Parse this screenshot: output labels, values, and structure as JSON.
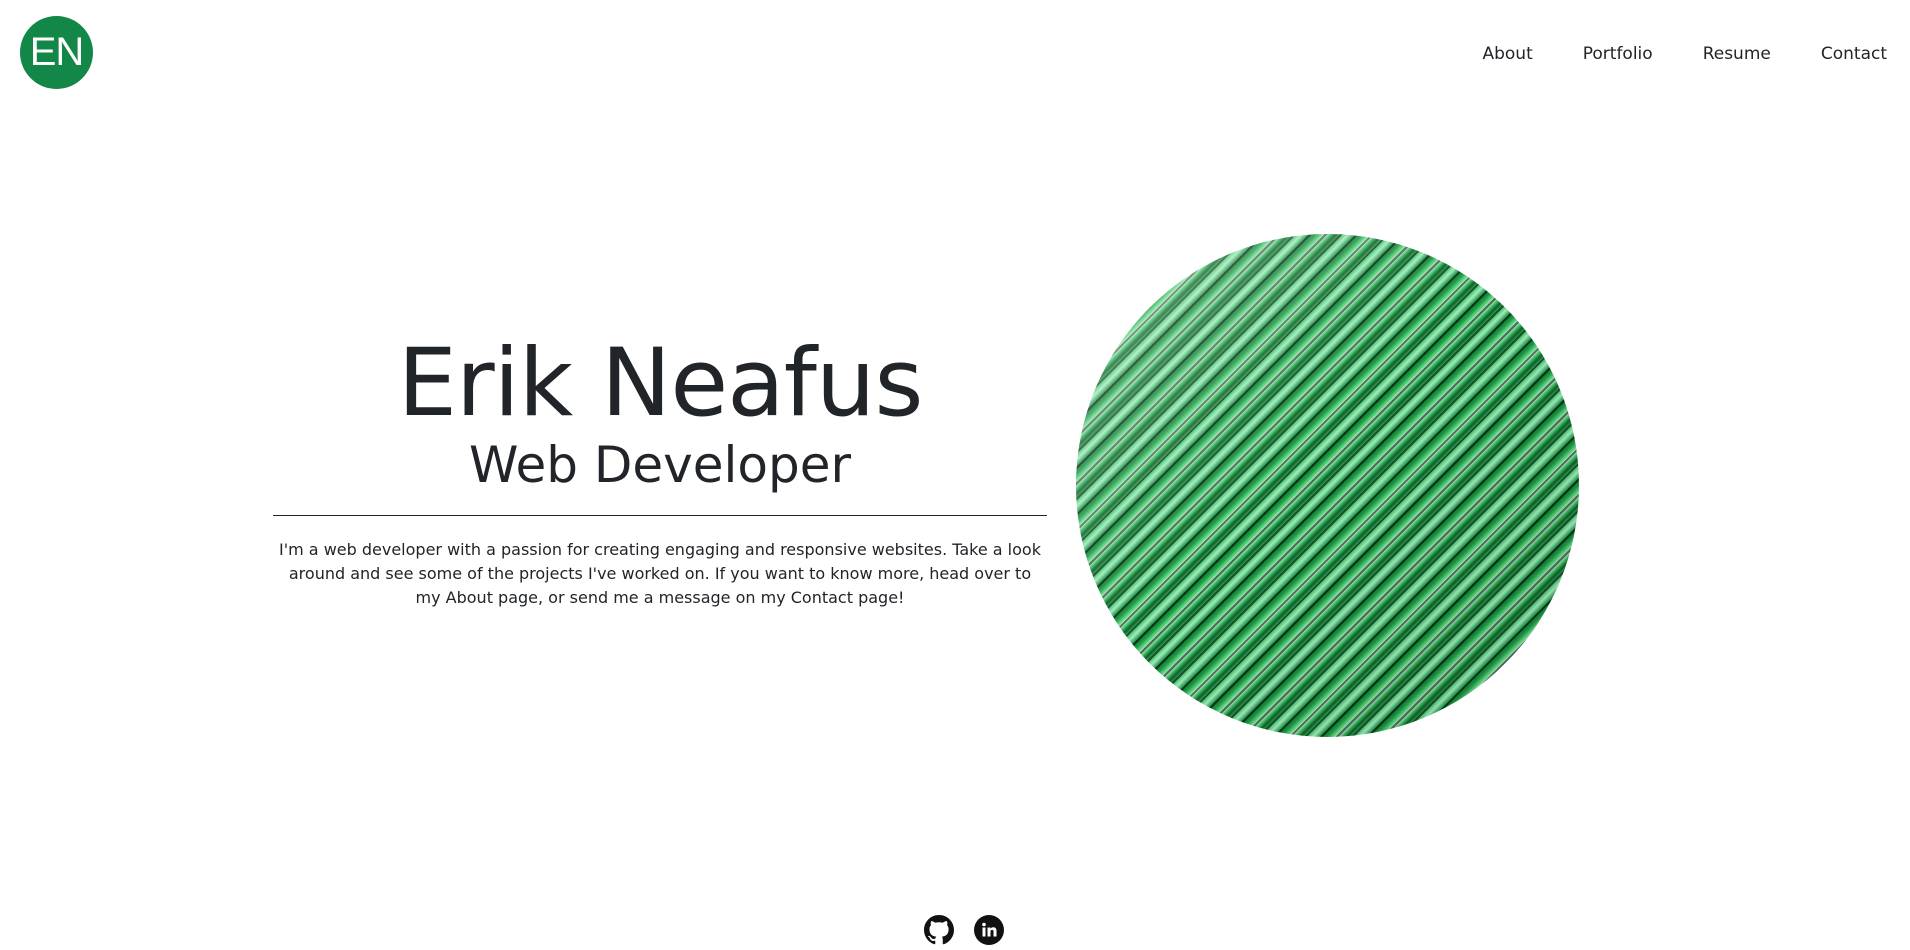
{
  "header": {
    "logo_text": "EN",
    "nav": [
      {
        "label": "About"
      },
      {
        "label": "Portfolio"
      },
      {
        "label": "Resume"
      },
      {
        "label": "Contact"
      }
    ]
  },
  "hero": {
    "name": "Erik Neafus",
    "role": "Web Developer",
    "intro": "I'm a web developer with a passion for creating engaging and responsive websites. Take a look around and see some of the projects I've worked on. If you want to know more, head over to my About page, or send me a message on my Contact page!",
    "image_icon": "green-abstract-image"
  },
  "footer": {
    "socials": [
      {
        "icon": "github-icon"
      },
      {
        "icon": "linkedin-icon"
      }
    ]
  },
  "colors": {
    "brand": "#128747",
    "text": "#212529",
    "background": "#ffffff"
  }
}
